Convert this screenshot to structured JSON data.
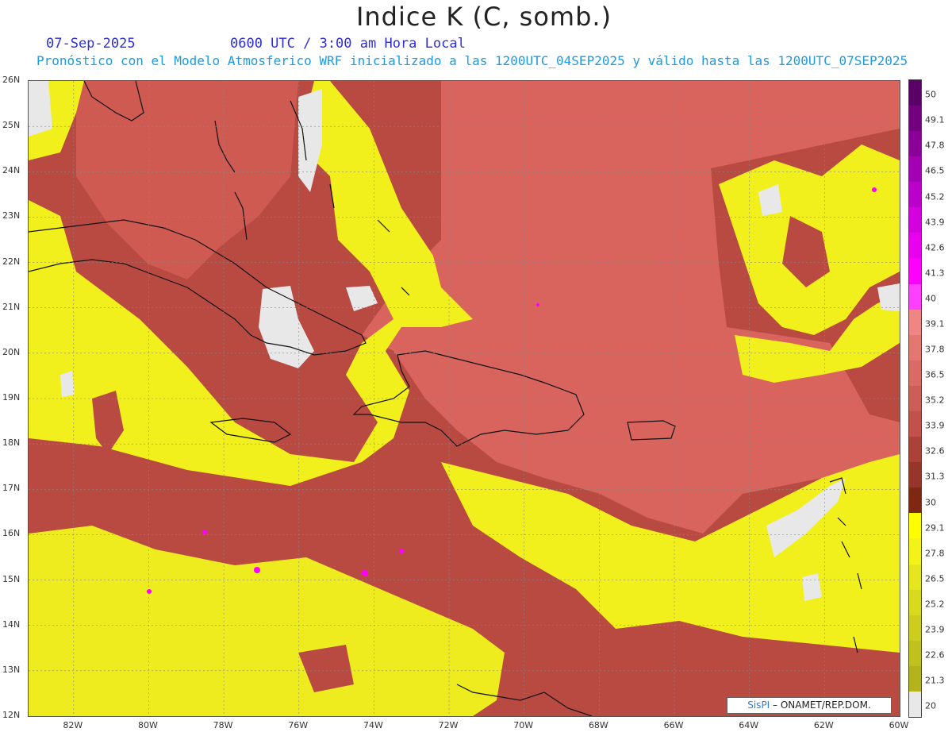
{
  "header": {
    "title": "Indice K (C, somb.)",
    "date": "07-Sep-2025",
    "time": "0600 UTC / 3:00 am Hora Local",
    "subtitle": "Pronóstico con el Modelo Atmosferico WRF inicializado a las 1200UTC_04SEP2025 y válido hasta las  1200UTC_07SEP2025"
  },
  "map": {
    "lat_labels": [
      "26N",
      "25N",
      "24N",
      "23N",
      "22N",
      "21N",
      "20N",
      "19N",
      "18N",
      "17N",
      "16N",
      "15N",
      "14N",
      "13N",
      "12N"
    ],
    "lon_labels": [
      "82W",
      "80W",
      "78W",
      "76W",
      "74W",
      "72W",
      "70W",
      "68W",
      "66W",
      "64W",
      "62W",
      "60W"
    ],
    "lat_range": [
      12,
      26
    ],
    "lon_range": [
      -83.2,
      -60
    ],
    "grid": true
  },
  "legend": {
    "labels": [
      "50",
      "49.1",
      "47.8",
      "46.5",
      "45.2",
      "43.9",
      "42.6",
      "41.3",
      "40",
      "39.1",
      "37.8",
      "36.5",
      "35.2",
      "33.9",
      "32.6",
      "31.3",
      "30",
      "29.1",
      "27.8",
      "26.5",
      "25.2",
      "23.9",
      "22.6",
      "21.3",
      "20"
    ],
    "colors": [
      "#5a0066",
      "#72007f",
      "#8a0099",
      "#a300b3",
      "#bb00cc",
      "#d400e0",
      "#e800ef",
      "#ff00ff",
      "#ff3fff",
      "#f08585",
      "#e57772",
      "#d96a64",
      "#cd5d57",
      "#c1514a",
      "#ac4237",
      "#98352a",
      "#7e2814",
      "#ffff00",
      "#f3f31a",
      "#e6e61f",
      "#d9d920",
      "#cdcd20",
      "#c0c01f",
      "#b3b31e",
      "#e8e8e8"
    ]
  },
  "credit": {
    "brand": "SisPI",
    "rest": "– ONAMET/REP.DOM."
  }
}
